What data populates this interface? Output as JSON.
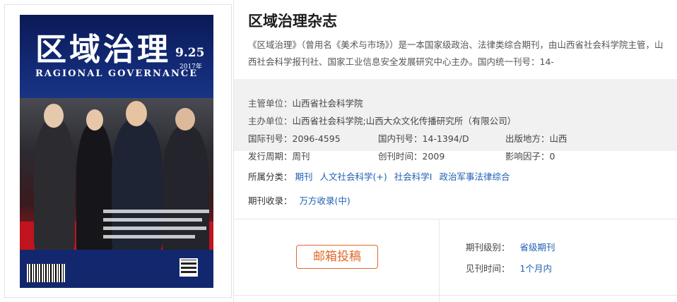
{
  "cover": {
    "title": "区域治理",
    "subtitle": "RAGIONAL GOVERNANCE",
    "issue": "9.25",
    "year": "2017年"
  },
  "journal": {
    "name": "区域治理杂志",
    "description": "《区域治理》（曾用名《美术与市场》）是一本国家级政治、法律类综合期刊，由山西省社会科学院主管，山西社会科学报刊社、国家工业信息安全发展研究中心主办。国内统一刊号：14-"
  },
  "meta": {
    "supervisor_label": "主管单位：",
    "supervisor": "山西省社会科学院",
    "sponsor_label": "主办单位：",
    "sponsor": "山西省社会科学院;山西大众文化传播研究所（有限公司）",
    "issn_label": "国际刊号：",
    "issn": "2096-4595",
    "cn_label": "国内刊号：",
    "cn": "14-1394/D",
    "place_label": "出版地方：",
    "place": "山西",
    "cycle_label": "发行周期：",
    "cycle": "周刊",
    "founded_label": "创刊时间：",
    "founded": "2009",
    "impact_label": "影响因子：",
    "impact": "0"
  },
  "categories": {
    "label": "所属分类：",
    "items": [
      "期刊",
      "人文社会科学(+)",
      "社会科学Ⅰ",
      "政治军事法律综合"
    ]
  },
  "inclusion": {
    "label": "期刊收录：",
    "items": [
      "万方收录(中)"
    ]
  },
  "actions": {
    "submit_label": "邮箱投稿"
  },
  "level": {
    "label": "期刊级别：",
    "value": "省级期刊"
  },
  "publish_time": {
    "label": "见刊时间：",
    "value": "1个月内"
  },
  "colors": {
    "link": "#1e5fb4",
    "button": "#e06a2a",
    "meta_bg": "#f1f1f1"
  }
}
